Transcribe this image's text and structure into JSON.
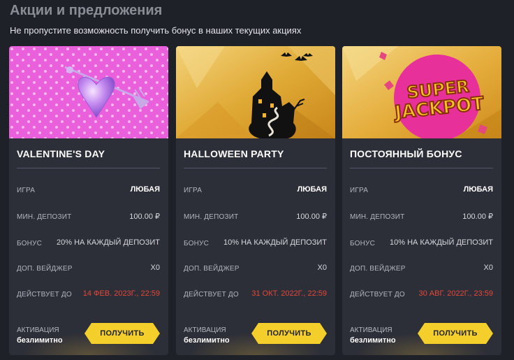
{
  "header": {
    "title": "Акции и предложения",
    "subtitle": "Не пропустите возможность получить бонус в наших текущих акциях"
  },
  "labels": {
    "game": "ИГРА",
    "min_deposit": "МИН. ДЕПОЗИТ",
    "bonus": "БОНУС",
    "wager": "ДОП. ВЕЙДЖЕР",
    "valid_until": "ДЕЙСТВУЕТ ДО",
    "activation": "АКТИВАЦИЯ",
    "activation_value": "безлимитно",
    "get_button": "ПОЛУЧИТЬ"
  },
  "colors": {
    "background": "#1f2129",
    "card": "#2c2e38",
    "button": "#f4cf2c",
    "expiry": "#e5483a"
  },
  "promos": [
    {
      "title": "VALENTINE'S DAY",
      "banner_icon": "heart-arrow-icon",
      "game": "ЛЮБАЯ",
      "min_deposit": "100.00 ₽",
      "bonus": "20% НА КАЖДЫЙ ДЕПОЗИТ",
      "wager": "X0",
      "valid_until": "14 ФЕВ. 2023Г., 22:59"
    },
    {
      "title": "HALLOWEEN PARTY",
      "banner_icon": "haunted-castle-icon",
      "game": "ЛЮБАЯ",
      "min_deposit": "100.00 ₽",
      "bonus": "10% НА КАЖДЫЙ ДЕПОЗИТ",
      "wager": "X0",
      "valid_until": "31 ОКТ. 2022Г., 22:59"
    },
    {
      "title": "ПОСТОЯННЫЙ БОНУС",
      "banner_icon": "super-jackpot-logo",
      "banner_text": "SUPER JACKPOT",
      "game": "ЛЮБАЯ",
      "min_deposit": "100.00 ₽",
      "bonus": "10% НА КАЖДЫЙ ДЕПОЗИТ",
      "wager": "X0",
      "valid_until": "30 АВГ. 2022Г., 23:59"
    }
  ]
}
